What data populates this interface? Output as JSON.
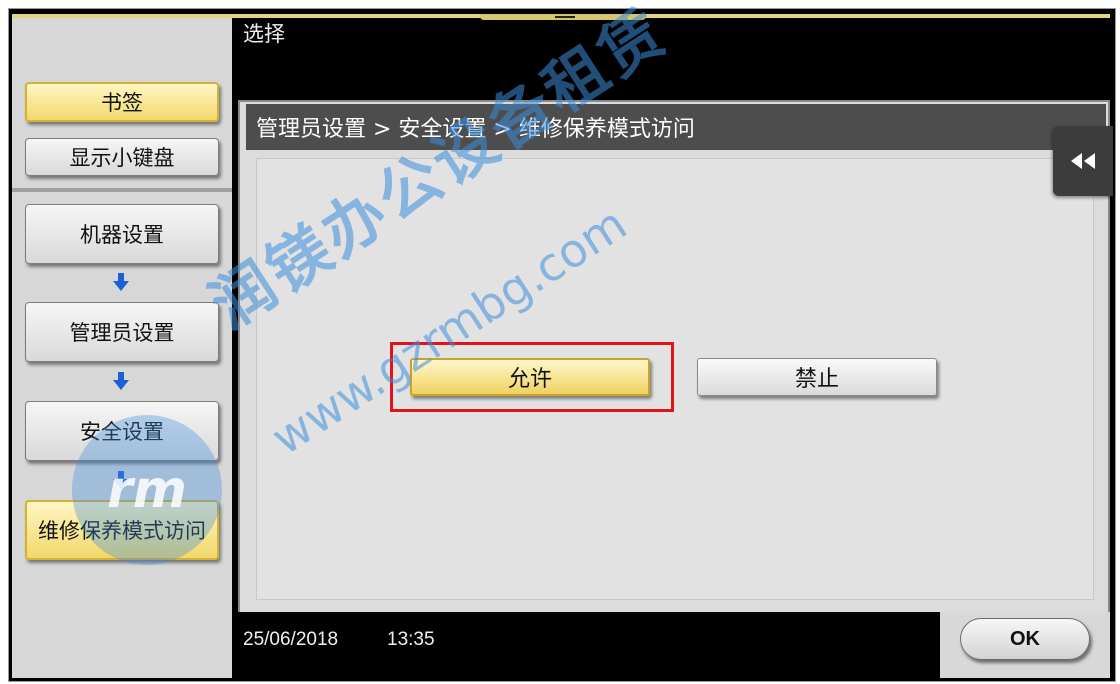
{
  "header": {
    "title": "选择"
  },
  "sidebar": {
    "bookmark_label": "书签",
    "keypad_label": "显示小键盘",
    "nav": [
      {
        "label": "机器设置"
      },
      {
        "label": "管理员设置"
      },
      {
        "label": "安全设置"
      },
      {
        "label": "维修保养模式访问"
      }
    ]
  },
  "breadcrumb": {
    "text": "管理员设置 > 安全设置 > 维修保养模式访问"
  },
  "options": {
    "allow_label": "允许",
    "deny_label": "禁止",
    "selected": "允许"
  },
  "status": {
    "date": "25/06/2018",
    "time": "13:35"
  },
  "footer": {
    "ok_label": "OK"
  },
  "watermark": {
    "text_cn": "润镁办公设备租赁",
    "text_url": "www.gzrmbg.com",
    "logo_text": "rm"
  },
  "icons": {
    "collapse": "double-left-arrow-icon",
    "step_arrow": "arrow-down-icon"
  },
  "colors": {
    "selected_button": "#f0d261",
    "highlight": "#e0121a",
    "arrow": "#1f5fd6",
    "watermark": "#3c8cdc"
  }
}
